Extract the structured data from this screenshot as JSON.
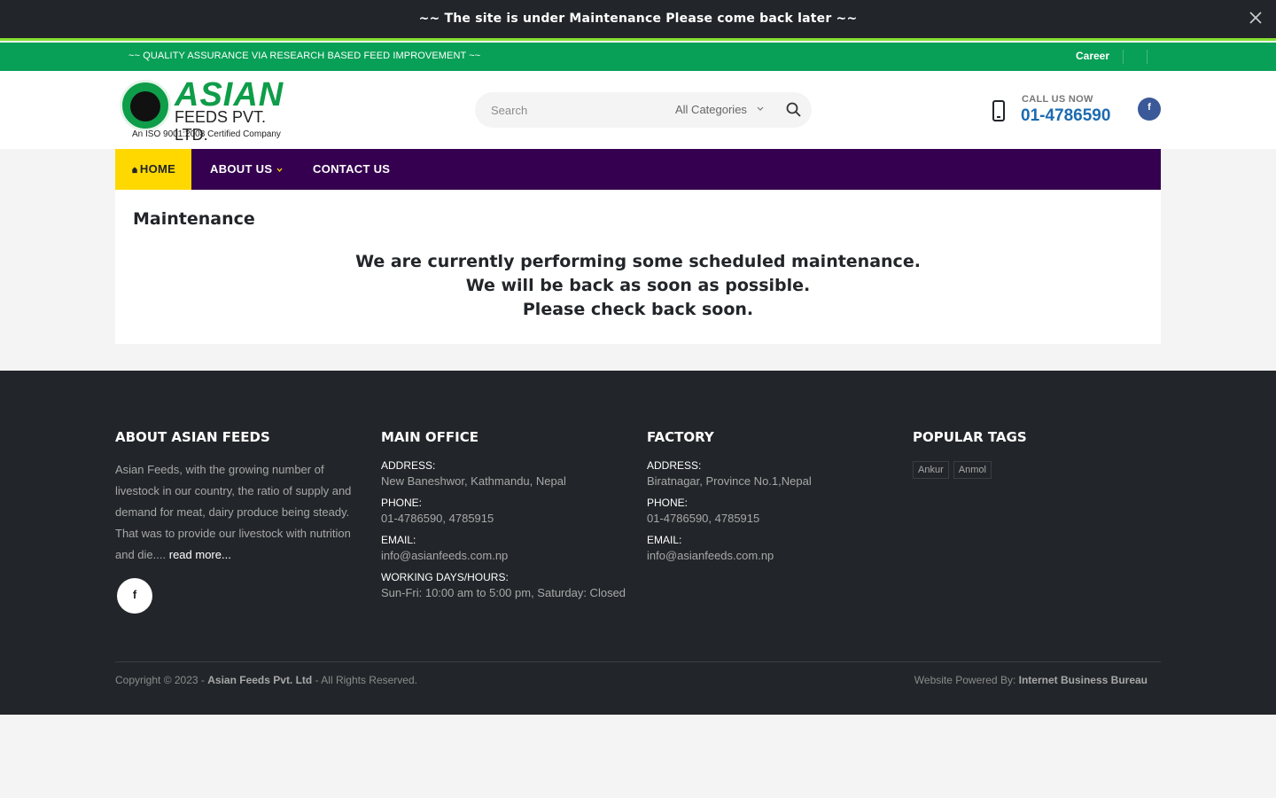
{
  "notice": {
    "text": "~~ The site is under Maintenance Please come back later ~~"
  },
  "topbar": {
    "tagline": "~~ QUALITY ASSURANCE VIA RESEARCH BASED FEED IMPROVEMENT ~~",
    "career": "Career"
  },
  "logo": {
    "name": "ASIAN",
    "sub": "FEEDS PVT. LTD.",
    "cert": "An ISO 9001:2008 Certified Company"
  },
  "search": {
    "placeholder": "Search",
    "category": "All Categories"
  },
  "call": {
    "label": "CALL US NOW",
    "number": "01-4786590"
  },
  "facebook": {
    "glyph": "f"
  },
  "nav": {
    "home": "HOME",
    "about": "ABOUT US",
    "contact": "CONTACT US"
  },
  "content": {
    "title": "Maintenance",
    "line1": "We are currently performing some scheduled maintenance.",
    "line2": "We will be back as soon as possible.",
    "line3": "Please check back soon."
  },
  "footer": {
    "about": {
      "heading": "ABOUT ASIAN FEEDS",
      "text": "Asian Feeds, with the growing number of livestock in our country, the ratio of supply and demand for meat, dairy produce being steady. That was to provide our livestock with nutrition and die....",
      "read_more": "read more..."
    },
    "main_office": {
      "heading": "MAIN OFFICE",
      "address_label": "ADDRESS:",
      "address": "New Baneshwor, Kathmandu, Nepal",
      "phone_label": "PHONE:",
      "phone": "01-4786590, 4785915",
      "email_label": "EMAIL:",
      "email": "info@asianfeeds.com.np",
      "hours_label": "WORKING DAYS/HOURS:",
      "hours": "Sun-Fri: 10:00 am to 5:00 pm, Saturday: Closed"
    },
    "factory": {
      "heading": "FACTORY",
      "address_label": "ADDRESS:",
      "address": "Biratnagar, Province No.1,Nepal",
      "phone_label": "PHONE:",
      "phone": "01-4786590, 4785915",
      "email_label": "EMAIL:",
      "email": "info@asianfeeds.com.np"
    },
    "tags": {
      "heading": "POPULAR TAGS",
      "items": [
        "Ankur",
        "Anmol"
      ]
    },
    "copyright_prefix": "Copyright © 2023 - ",
    "company": "Asian Feeds Pvt. Ltd",
    "copyright_suffix": " - All Rights Reserved.",
    "powered_prefix": "Website Powered By: ",
    "powered_by": "Internet Business Bureau"
  },
  "colors": {
    "accent_green": "#08a056",
    "nav_purple": "#34004f",
    "nav_active": "#ffd800",
    "call_blue": "#1c6ab0",
    "footer_bg": "#222529"
  },
  "icons": [
    "close-icon",
    "chevron-down-icon",
    "search-icon",
    "phone-icon",
    "facebook-icon",
    "home-icon"
  ]
}
